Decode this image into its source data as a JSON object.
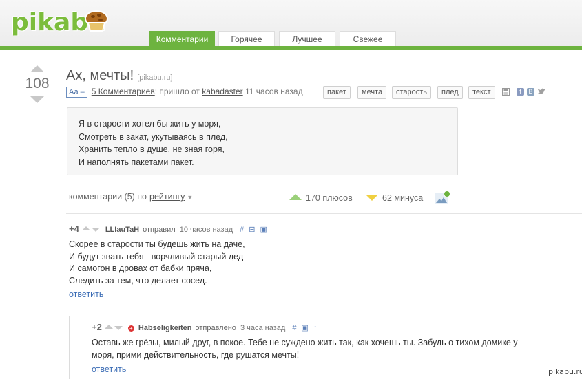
{
  "header": {
    "logo": "pikabu",
    "tabs": [
      "Комментарии",
      "Горячее",
      "Лучшее",
      "Свежее"
    ],
    "active_tab": "Комментарии"
  },
  "post": {
    "rating": "108",
    "title": "Ах, мечты!",
    "source": "[pikabu.ru]",
    "aa_badge": "Аа –",
    "comments_link": "5 Комментариев",
    "from_text": "; пришло от",
    "author": "kabadaster",
    "time": "11 часов назад",
    "tags": [
      "пакет",
      "мечта",
      "старость",
      "плед",
      "текст"
    ],
    "quote": [
      "Я в старости хотел бы жить у моря,",
      "Смотреть в закат, укутываясь в плед,",
      "Хранить тепло в душе, не зная горя,",
      "И наполнять пакетами пакет."
    ]
  },
  "comments_bar": {
    "label": "комментарии (5) по",
    "sort": "рейтингу",
    "plus": "170 плюсов",
    "minus": "62 минуса"
  },
  "comments": [
    {
      "score": "+4",
      "user": "LLIauTaH",
      "action": "отправил",
      "time": "10 часов назад",
      "lines": [
        "Скорее в старости ты будешь жить на даче,",
        "И будут звать тебя - ворчливый старый дед",
        "И самогон в дровах от бабки пряча,",
        "Следить за тем, что делает сосед."
      ],
      "reply": "ответить"
    },
    {
      "score": "+2",
      "user": "Habseligkeiten",
      "action": "отправлено",
      "time": "3 часа назад",
      "lines": [
        "Оставь же грёзы, милый друг, в покое. Тебе не суждено жить так, как хочешь ты. Забудь о тихом домике у",
        "моря, прими действительность, где рушатся мечты!"
      ],
      "reply": "ответить"
    }
  ],
  "watermark": "pikabu.ru",
  "colors": {
    "brand_green": "#6db33f",
    "link_blue": "#3b6cb5"
  }
}
